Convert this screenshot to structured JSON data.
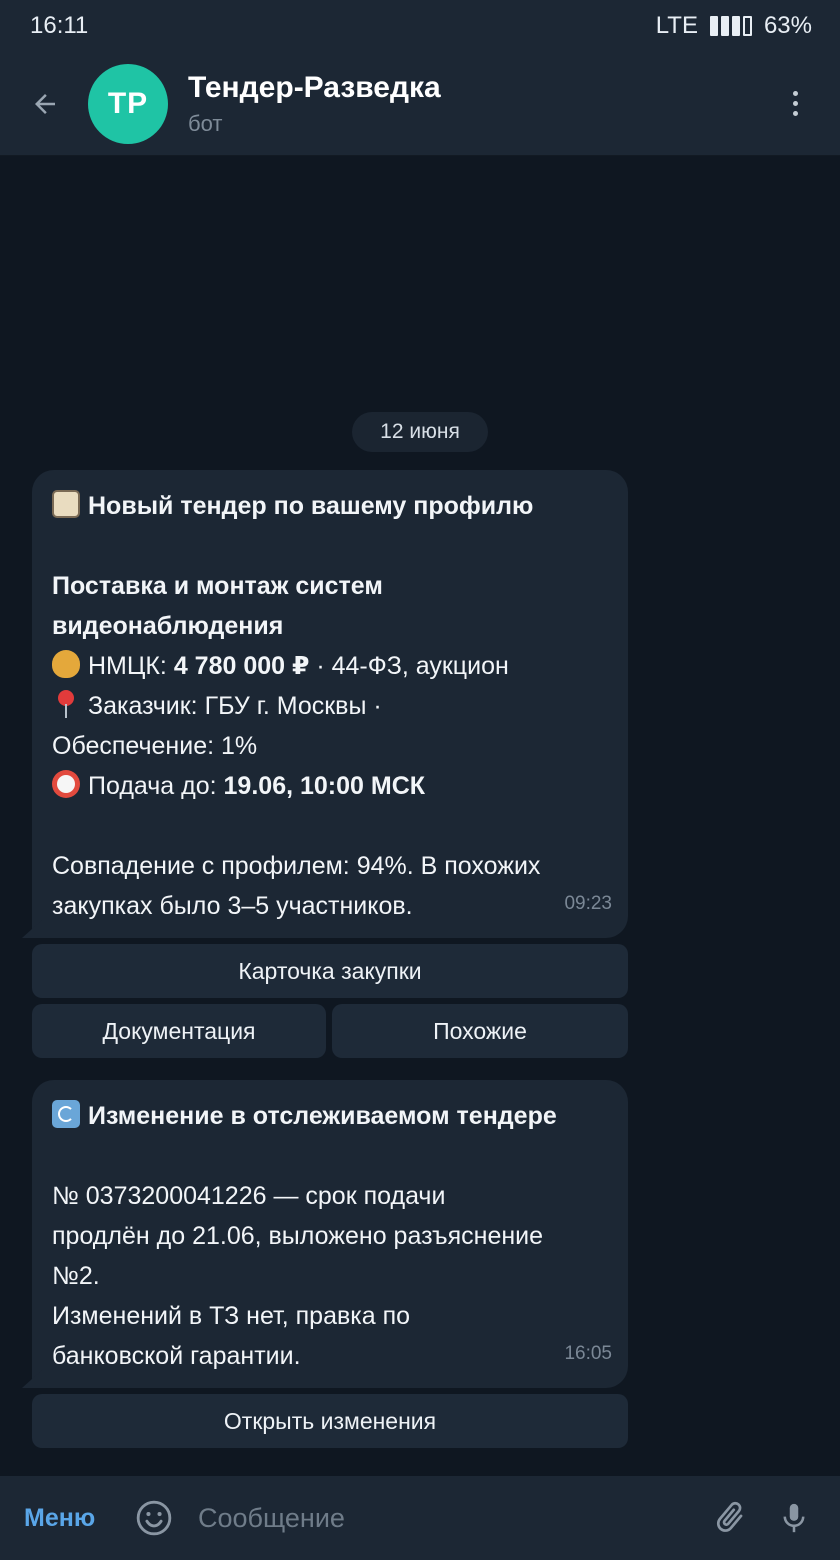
{
  "status_bar": {
    "time": "16:11",
    "network": "LTE",
    "battery": "63%"
  },
  "header": {
    "avatar_initials": "TP",
    "title": "Тендер-Разведка",
    "subtitle": "бот",
    "back_icon": "arrow-left-icon",
    "menu_icon": "more-vertical-icon"
  },
  "date_chip": "12 июня",
  "messages": [
    {
      "heading": "Новый тендер по вашему профилю",
      "subject_line1": "Поставка и монтаж систем",
      "subject_line2": "видеонаблюдения",
      "price_label": "НМЦК: ",
      "price_value": "4 780 000 ₽",
      "price_suffix": " · 44-ФЗ, аукцион",
      "customer_line1": "Заказчик: ГБУ г. Москвы ·",
      "customer_line2": "Обеспечение: 1%",
      "deadline_label": "Подача до: ",
      "deadline_value": "19.06, 10:00 МСК",
      "match_line1": "Совпадение с профилем: 94%. В похожих",
      "match_line2": "закупках было 3–5 участников.",
      "time": "09:23"
    },
    {
      "heading": "Изменение в отслеживаемом тендере",
      "line1": "№ 0373200041226 — срок подачи",
      "line2": "продлён до 21.06, выложено разъяснение",
      "line3": "№2.",
      "line4": "Изменений в ТЗ нет, правка по",
      "line5": "банковской гарантии.",
      "time": "16:05"
    }
  ],
  "buttons": {
    "card": "Карточка закупки",
    "docs": "Документация",
    "similar": "Похожие",
    "open_changes": "Открыть изменения"
  },
  "input_bar": {
    "menu_label": "Меню",
    "placeholder": "Сообщение"
  },
  "colors": {
    "background": "#0f1721",
    "panel": "#1c2734",
    "accent": "#5aa6e8",
    "avatar": "#1fc4a5"
  }
}
